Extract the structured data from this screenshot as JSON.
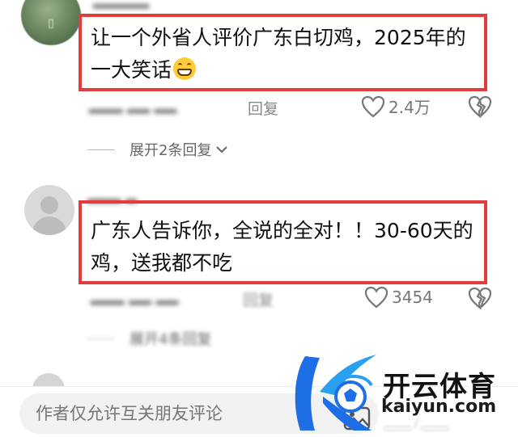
{
  "comments": [
    {
      "text_line1": "让一个外省人评价广东白切鸡，2025年的",
      "text_line2": "一大笑话",
      "emoji": "grinning-face",
      "reply_label": "回复",
      "likes": "2.4万",
      "expand_label": "展开2条回复"
    },
    {
      "text_line1": "广东人告诉你，全说的全对！！30-60天的",
      "text_line2": "鸡，送我都不吃",
      "reply_label": "回复",
      "likes": "3454",
      "expand_label": "展开4条回复"
    }
  ],
  "composer": {
    "placeholder": "作者仅允许互关朋友评论"
  },
  "watermark": {
    "title": "开云体育",
    "url": "kaiyun.com"
  },
  "colors": {
    "highlight_border": "#e23c3c",
    "brand_blue": "#1e6ee6",
    "muted_text": "#777777"
  }
}
